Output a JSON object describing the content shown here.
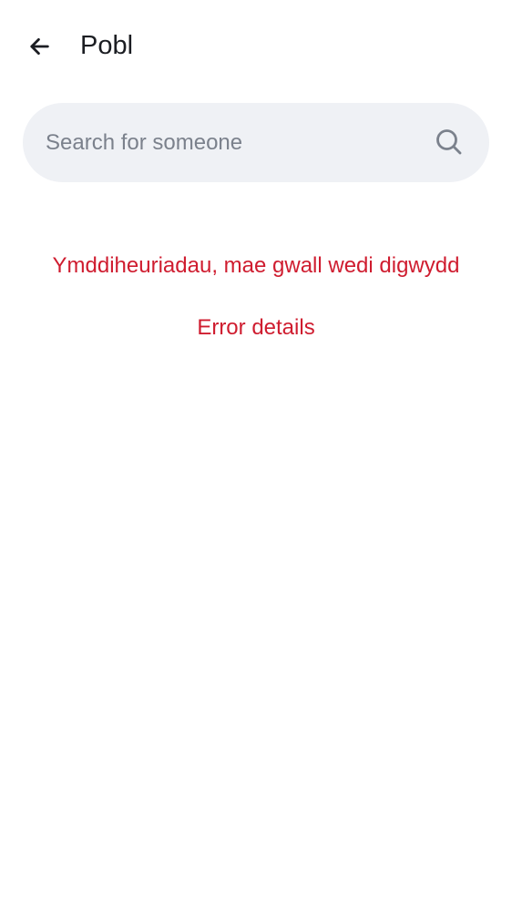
{
  "app_bar": {
    "back_icon": "arrow-left-icon",
    "title": "Pobl"
  },
  "search": {
    "placeholder": "Search for someone",
    "value": "",
    "icon": "search-icon"
  },
  "error": {
    "message": "Ymddiheuriadau, mae gwall wedi digwydd",
    "details_label": "Error details"
  },
  "colors": {
    "background": "#ffffff",
    "title_text": "#1b1d22",
    "search_background": "#eff1f5",
    "placeholder_text": "#7b818c",
    "error_text": "#cf1c2f"
  }
}
